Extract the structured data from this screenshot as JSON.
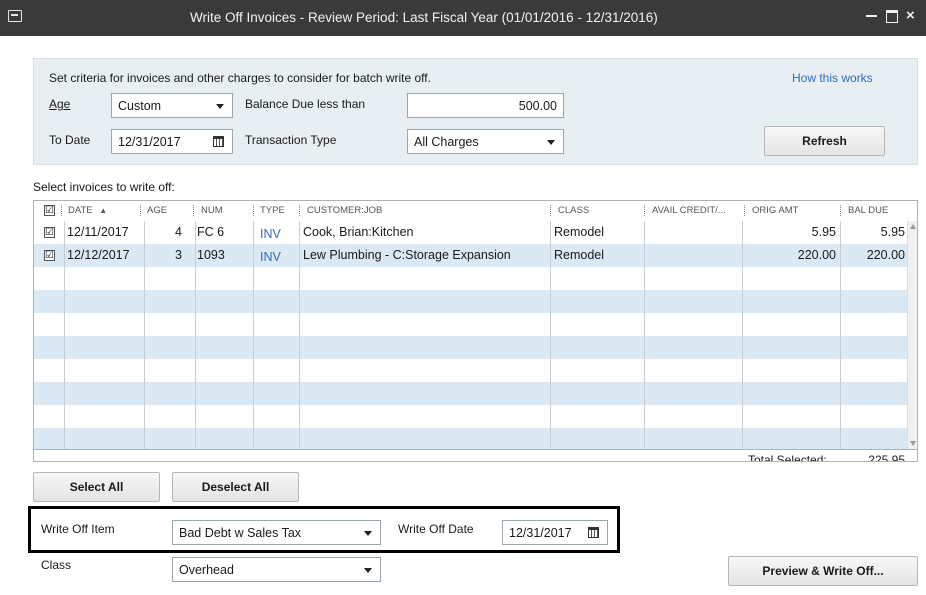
{
  "window": {
    "title": "Write Off Invoices - Review Period: Last Fiscal Year (01/01/2016 - 12/31/2016)"
  },
  "criteria": {
    "instructions": "Set criteria for invoices and other charges to consider for batch write off.",
    "help_link": "How this works",
    "age_label": "Age",
    "age_value": "Custom",
    "balance_label": "Balance Due less than",
    "balance_value": "500.00",
    "to_date_label": "To Date",
    "to_date_value": "12/31/2017",
    "transaction_type_label": "Transaction Type",
    "transaction_type_value": "All Charges",
    "refresh_button": "Refresh"
  },
  "grid": {
    "caption": "Select invoices to write off:",
    "columns": {
      "date": "DATE",
      "age": "AGE",
      "num": "NUM",
      "type": "TYPE",
      "customer_job": "CUSTOMER:JOB",
      "class": "CLASS",
      "avail_credit": "AVAIL CREDIT/...",
      "orig_amt": "ORIG AMT",
      "bal_due": "BAL DUE"
    },
    "rows": [
      {
        "checked": "☑",
        "date": "12/11/2017",
        "age": "4",
        "num": "FC 6",
        "type": "INV",
        "customer_job": "Cook, Brian:Kitchen",
        "class": "Remodel",
        "avail_credit": "",
        "orig_amt": "5.95",
        "bal_due": "5.95"
      },
      {
        "checked": "☑",
        "date": "12/12/2017",
        "age": "3",
        "num": "1093",
        "type": "INV",
        "customer_job": "Lew Plumbing - C:Storage Expansion",
        "class": "Remodel",
        "avail_credit": "",
        "orig_amt": "220.00",
        "bal_due": "220.00"
      }
    ],
    "total_label": "Total Selected:",
    "total_value": "225.95"
  },
  "actions": {
    "select_all": "Select All",
    "deselect_all": "Deselect All",
    "preview_write_off": "Preview & Write Off..."
  },
  "write_off": {
    "item_label": "Write Off Item",
    "item_value": "Bad Debt w Sales Tax",
    "date_label": "Write Off Date",
    "date_value": "12/31/2017",
    "class_label": "Class",
    "class_value": "Overhead"
  },
  "icons": {
    "checkbox_checked": "☑",
    "sort_ascending": "▲"
  }
}
